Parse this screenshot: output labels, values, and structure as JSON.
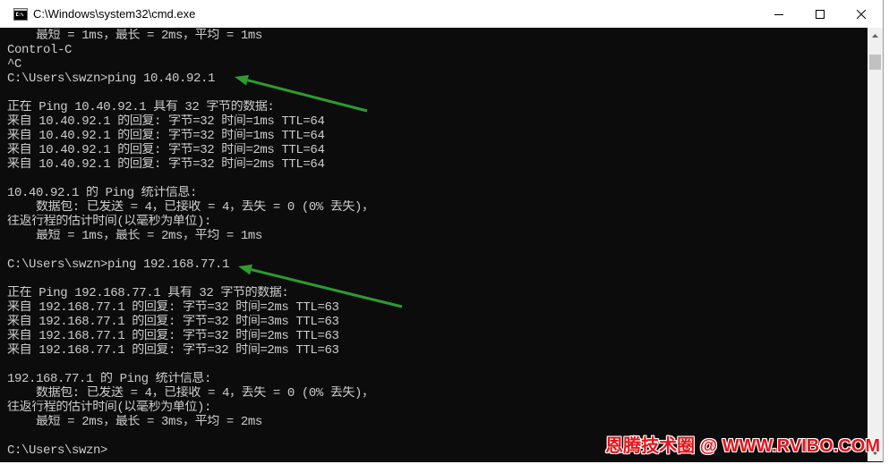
{
  "window": {
    "title": "C:\\Windows\\system32\\cmd.exe",
    "icons": {
      "app": "cmd-icon",
      "minimize": "minimize-icon",
      "maximize": "maximize-icon",
      "close": "close-icon",
      "scroll_up": "chevron-up-icon",
      "scroll_down": "chevron-down-icon"
    }
  },
  "console": {
    "lines": [
      "    最短 = 1ms，最长 = 2ms，平均 = 1ms",
      "Control-C",
      "^C",
      "C:\\Users\\swzn>ping 10.40.92.1",
      "",
      "正在 Ping 10.40.92.1 具有 32 字节的数据:",
      "来自 10.40.92.1 的回复: 字节=32 时间=1ms TTL=64",
      "来自 10.40.92.1 的回复: 字节=32 时间=1ms TTL=64",
      "来自 10.40.92.1 的回复: 字节=32 时间=2ms TTL=64",
      "来自 10.40.92.1 的回复: 字节=32 时间=2ms TTL=64",
      "",
      "10.40.92.1 的 Ping 统计信息:",
      "    数据包: 已发送 = 4，已接收 = 4，丢失 = 0 (0% 丢失)，",
      "往返行程的估计时间(以毫秒为单位):",
      "    最短 = 1ms，最长 = 2ms，平均 = 1ms",
      "",
      "C:\\Users\\swzn>ping 192.168.77.1",
      "",
      "正在 Ping 192.168.77.1 具有 32 字节的数据:",
      "来自 192.168.77.1 的回复: 字节=32 时间=2ms TTL=63",
      "来自 192.168.77.1 的回复: 字节=32 时间=3ms TTL=63",
      "来自 192.168.77.1 的回复: 字节=32 时间=2ms TTL=63",
      "来自 192.168.77.1 的回复: 字节=32 时间=2ms TTL=63",
      "",
      "192.168.77.1 的 Ping 统计信息:",
      "    数据包: 已发送 = 4，已接收 = 4，丢失 = 0 (0% 丢失)，",
      "往返行程的估计时间(以毫秒为单位):",
      "    最短 = 2ms，最长 = 3ms，平均 = 2ms",
      "",
      "C:\\Users\\swzn>"
    ]
  },
  "watermark": {
    "text": "恩腾技术圈 @ WWW.RVIBO.COM"
  },
  "colors": {
    "titlebar_background": "#ffffff",
    "console_background": "#0c0c0c",
    "console_text": "#cccccc",
    "scrollbar_track": "#f0f0f0",
    "scrollbar_thumb": "#c1c1c1",
    "annotation_arrow": "#2e9b30",
    "watermark_text": "#e8141c"
  }
}
